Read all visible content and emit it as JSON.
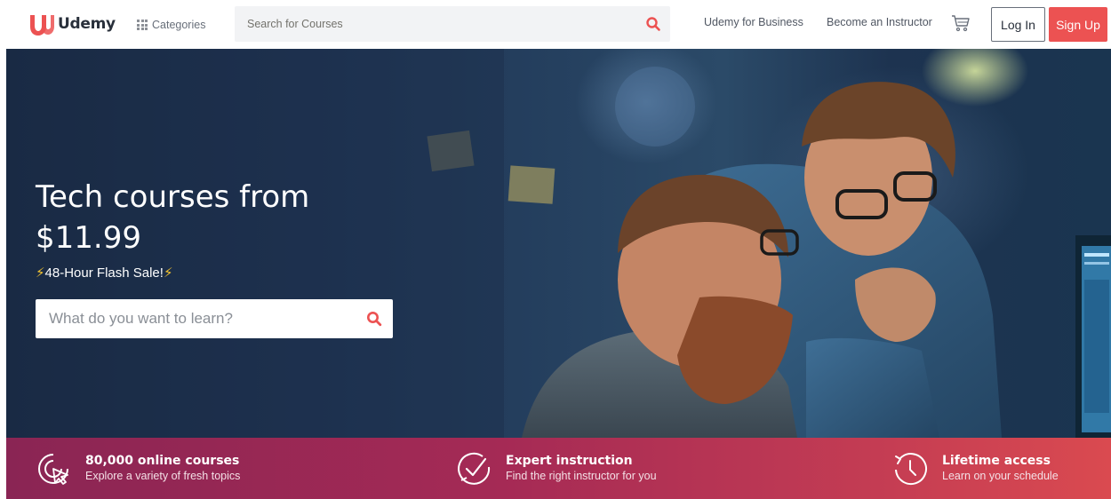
{
  "brand": {
    "name": "Udemy",
    "accent": "#ec5252",
    "text": "#29303b"
  },
  "header": {
    "categories_label": "Categories",
    "search_placeholder": "Search for Courses",
    "business_link": "Udemy for Business",
    "instructor_link": "Become an Instructor",
    "cart_icon": "cart-icon",
    "login_label": "Log In",
    "signup_label": "Sign Up"
  },
  "hero": {
    "title_line1": "Tech courses from",
    "title_line2": "$11.99",
    "sale_text": "48-Hour Flash Sale!",
    "search_placeholder": "What do you want to learn?"
  },
  "features": [
    {
      "icon": "cursor-click-icon",
      "title": "80,000 online courses",
      "subtitle": "Explore a variety of fresh topics"
    },
    {
      "icon": "check-badge-icon",
      "title": "Expert instruction",
      "subtitle": "Find the right instructor for you"
    },
    {
      "icon": "clock-history-icon",
      "title": "Lifetime access",
      "subtitle": "Learn on your schedule"
    }
  ]
}
